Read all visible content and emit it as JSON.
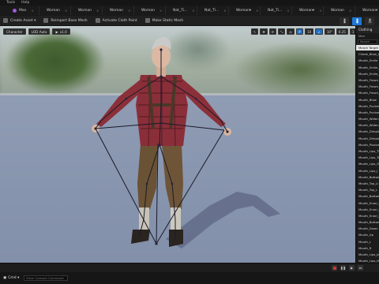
{
  "menu": [
    "Tools",
    "Help"
  ],
  "tabs": [
    {
      "label": "Man",
      "color": "#a05ad8"
    },
    {
      "label": "Woman",
      "color": "#a05ad8"
    },
    {
      "label": "Woman",
      "color": "#a05ad8"
    },
    {
      "label": "Woman",
      "color": "#a05ad8"
    },
    {
      "label": "Woman",
      "color": "#a05ad8"
    },
    {
      "label": "Nat_Ti...",
      "color": "#39c36a"
    },
    {
      "label": "Nat_Ti...",
      "color": "#39c36a"
    },
    {
      "label": "Woman▾",
      "color": "#a05ad8"
    },
    {
      "label": "Nat_Ti...",
      "color": "#39c36a"
    },
    {
      "label": "Woman▾",
      "color": "#a05ad8"
    },
    {
      "label": "Woman",
      "color": "#a05ad8"
    },
    {
      "label": "Woman▾",
      "color": "#a05ad8"
    }
  ],
  "toolbar": {
    "create_asset": "Create Asset ▾",
    "reimport": "Reimport Base Mesh",
    "activate_cloth": "Activate Cloth Paint",
    "make_static": "Make Static Mesh"
  },
  "viewport": {
    "perspective": "Character",
    "lod": "LOD Auto",
    "speed": "x1.0",
    "snap_value": "10",
    "zoom_value": "0.25",
    "grid_value": "1"
  },
  "panel": {
    "title": "Clothing",
    "head": "Man",
    "search_placeholder": "Search",
    "items": [
      "Morph Target",
      "Cheek_Blow_L",
      "Mouth_Smile",
      "Mouth_Smile_R",
      "Mouth_Smile_L",
      "Mouth_Frown",
      "Mouth_Frown_L",
      "Mouth_Frown_R",
      "Mouth_Blow",
      "Mouth_Pucker",
      "Mouth_Pucker_L",
      "Mouth_Widen",
      "Mouth_Widen_L",
      "Mouth_Dimple_L",
      "Mouth_Dimple_R",
      "Mouth_Plosive",
      "Mouth_Lips_Ti",
      "Mouth_Lips_Tu",
      "Mouth_Lips_Op",
      "Mouth_Lips_J",
      "Mouth_Bottom",
      "Mouth_Top_Li",
      "Mouth_Top_L",
      "Mouth_Bottom_L",
      "Mouth_Snarl_U",
      "Mouth_Snarl_L",
      "Mouth_Snarl_R",
      "Mouth_Bottom_R",
      "Mouth_Down",
      "Mouth_Up",
      "Mouth_L",
      "Mouth_R",
      "Mouth_Lips_Ja",
      "Mouth_Lips_H"
    ]
  },
  "status": {
    "cmd_label": "Cmd ▾",
    "cmd_placeholder": "Enter Console Command"
  }
}
